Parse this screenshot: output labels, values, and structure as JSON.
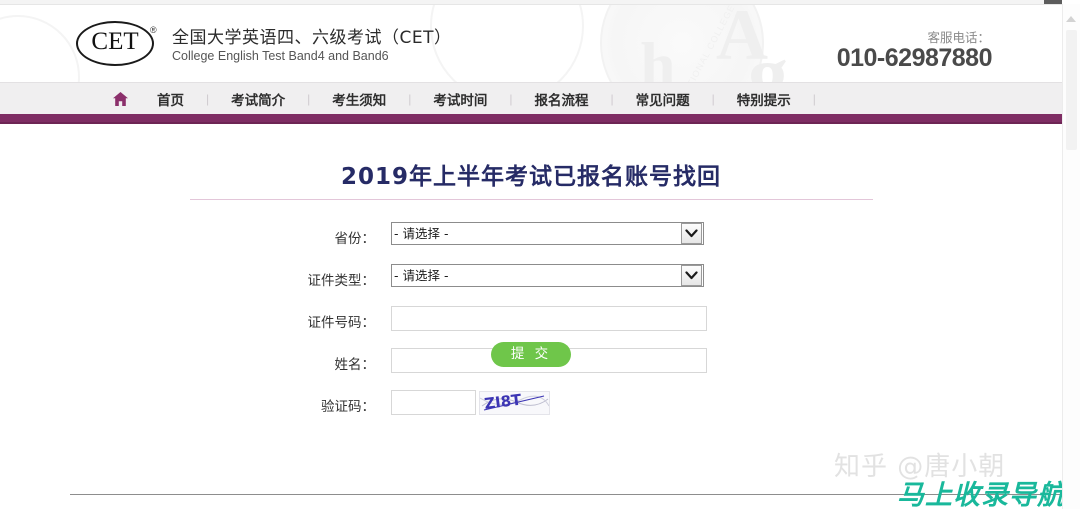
{
  "site": {
    "logo_text": "CET",
    "logo_registered": "®",
    "title_cn": "全国大学英语四、六级考试（CET）",
    "title_en": "College English Test Band4 and Band6",
    "hotline_label": "客服电话：",
    "hotline_number": "010-62987880",
    "ghost_letters": {
      "a": "A",
      "g": "g",
      "h": "h",
      "seal_text": "NATIONAL COLLEGE ENGLISH TEST"
    }
  },
  "nav": {
    "home_icon": "home-icon",
    "items": [
      {
        "label": "首页"
      },
      {
        "label": "考试简介"
      },
      {
        "label": "考生须知"
      },
      {
        "label": "考试时间"
      },
      {
        "label": "报名流程"
      },
      {
        "label": "常见问题"
      },
      {
        "label": "特别提示"
      }
    ],
    "separator": "|",
    "bar_color": "#7e2d63"
  },
  "main": {
    "page_title": "2019年上半年考试已报名账号找回"
  },
  "form": {
    "rows": [
      {
        "label": "省份：",
        "type": "select",
        "value": "- 请选择 -",
        "name": "province"
      },
      {
        "label": "证件类型：",
        "type": "select",
        "value": "- 请选择 -",
        "name": "id-type"
      },
      {
        "label": "证件号码：",
        "type": "text",
        "value": "",
        "placeholder": "",
        "name": "id-number"
      },
      {
        "label": "姓名：",
        "type": "text",
        "value": "",
        "placeholder": "",
        "name": "full-name"
      },
      {
        "label": "验证码：",
        "type": "captcha",
        "value": "",
        "placeholder": "",
        "name": "captcha"
      }
    ],
    "select_placeholder": "- 请选择 -",
    "select_options": [
      "- 请选择 -"
    ],
    "captcha_text": "ZI8T",
    "captcha_color": "#3c35b4",
    "submit_label": "提 交",
    "submit_color": "#6fc64a"
  },
  "watermarks": {
    "zhihu": "知乎 @唐小朝",
    "nav_site": "马上收录导航",
    "nav_site_color": "#19b89b"
  },
  "scrollbar": {
    "up_arrow": "scroll-up-arrow"
  }
}
